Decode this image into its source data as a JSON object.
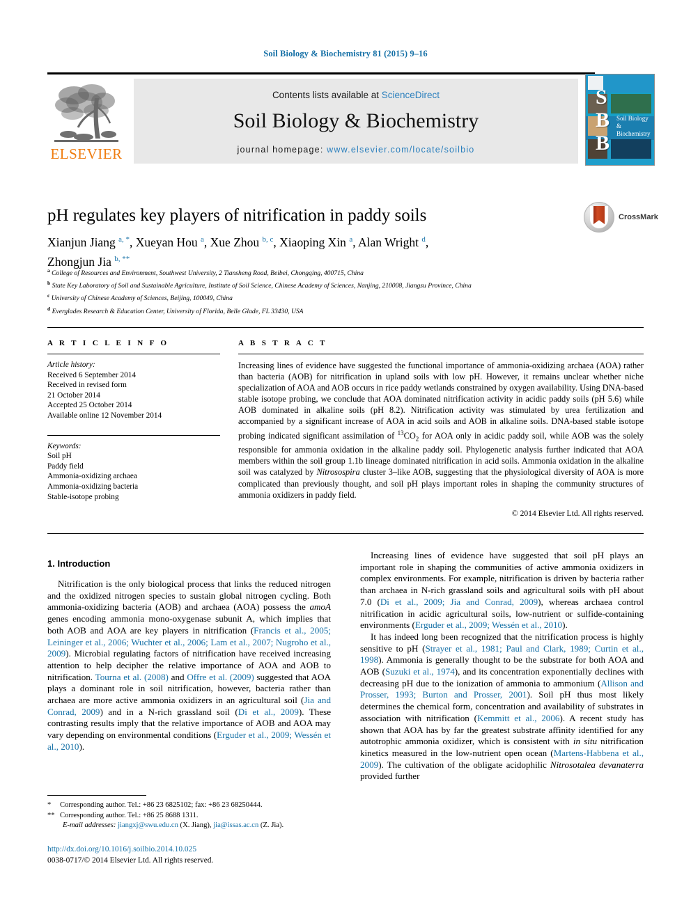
{
  "running_head": "Soil Biology & Biochemistry 81 (2015) 9–16",
  "masthead": {
    "contents_prefix": "Contents lists available at ",
    "sciencedirect": "ScienceDirect",
    "journal_title": "Soil Biology & Biochemistry",
    "homepage_label": "journal homepage: ",
    "homepage_url": "www.elsevier.com/locate/soilbio",
    "elsevier_wordmark": "ELSEVIER",
    "cover_letters": "S\nB\nB",
    "cover_name": "Soil Biology & Biochemistry"
  },
  "crossmark": {
    "label": "CrossMark"
  },
  "article": {
    "title": "pH regulates key players of nitrification in paddy soils",
    "authors_line1": "Xianjun Jiang a, *, Xueyan Hou a, Xue Zhou b, c, Xiaoping Xin a, Alan Wright d,",
    "authors_line2": "Zhongjun Jia b, **",
    "affiliations": [
      {
        "mark": "a",
        "text": "College of Resources and Environment, Southwest University, 2 Tiansheng Road, Beibei, Chongqing, 400715, China"
      },
      {
        "mark": "b",
        "text": "State Key Laboratory of Soil and Sustainable Agriculture, Institute of Soil Science, Chinese Academy of Sciences, Nanjing, 210008, Jiangsu Province, China"
      },
      {
        "mark": "c",
        "text": "University of Chinese Academy of Sciences, Beijing, 100049, China"
      },
      {
        "mark": "d",
        "text": "Everglades Research & Education Center, University of Florida, Belle Glade, FL 33430, USA"
      }
    ]
  },
  "article_info": {
    "heading": "A R T I C L E   I N F O",
    "history_label": "Article history:",
    "history": [
      "Received 6 September 2014",
      "Received in revised form",
      "21 October 2014",
      "Accepted 25 October 2014",
      "Available online 12 November 2014"
    ],
    "keywords_label": "Keywords:",
    "keywords": [
      "Soil pH",
      "Paddy field",
      "Ammonia-oxidizing archaea",
      "Ammonia-oxidizing bacteria",
      "Stable-isotope probing"
    ]
  },
  "abstract": {
    "heading": "A B S T R A C T",
    "p1": "Increasing lines of evidence have suggested the functional importance of ammonia-oxidizing archaea (AOA) rather than bacteria (AOB) for nitrification in upland soils with low pH. However, it remains unclear whether niche specialization of AOA and AOB occurs in rice paddy wetlands constrained by oxygen availability. Using DNA-based stable isotope probing, we conclude that AOA dominated nitrification activity in acidic paddy soils (pH 5.6) while AOB dominated in alkaline soils (pH 8.2). Nitrification activity was stimulated by urea fertilization and accompanied by a significant increase of AOA in acid soils and AOB in alkaline soils. DNA-based stable isotope probing indicated significant assimilation of ",
    "iso": "13",
    "iso_tail": "CO",
    "iso_sub": "2",
    "p2": " for AOA only in acidic paddy soil, while AOB was the solely responsible for ammonia oxidation in the alkaline paddy soil. Phylogenetic analysis further indicated that AOA members within the soil group 1.1b lineage dominated nitrification in acid soils. Ammonia oxidation in the alkaline soil was catalyzed by ",
    "genus": "Nitrosospira",
    "p3": " cluster 3–like AOB, suggesting that the physiological diversity of AOA is more complicated than previously thought, and soil pH plays important roles in shaping the community structures of ammonia oxidizers in paddy field.",
    "copyright": "© 2014 Elsevier Ltd. All rights reserved."
  },
  "body": {
    "intro_heading": "1.  Introduction",
    "left_p1_a": "Nitrification is the only biological process that links the reduced nitrogen and the oxidized nitrogen species to sustain global nitrogen cycling. Both ammonia-oxidizing bacteria (AOB) and archaea (AOA) possess the ",
    "left_p1_amoa": "amoA",
    "left_p1_b": " genes encoding ammonia mono-oxygenase subunit A, which implies that both AOB and AOA are key players in nitrification (",
    "left_cite1": "Francis et al., 2005; Leininger et al., 2006; Wuchter et al., 2006; Lam et al., 2007; Nugroho et al., 2009",
    "left_p1_c": "). Microbial regulating factors of nitrification have received increasing attention to help decipher the relative importance of AOA and AOB to nitrification. ",
    "left_cite2": "Tourna et al. (2008)",
    "left_p1_d": " and ",
    "left_cite3": "Offre et al. (2009)",
    "left_p1_e": " suggested that AOA plays a dominant role in soil nitrification, however, bacteria rather than archaea are more active ammonia oxidizers in an agricultural soil (",
    "left_cite4": "Jia and Conrad, 2009",
    "left_p1_f": ") and in a N-rich grassland soil (",
    "left_cite5": "Di et al., 2009",
    "left_p1_g": "). These contrasting results imply that the relative importance of AOB and AOA may vary depending on environmental conditions (",
    "left_cite6": "Erguder et al., 2009; Wessén et al., 2010",
    "left_p1_h": ").",
    "right_p1_a": "Increasing lines of evidence have suggested that soil pH plays an important role in shaping the communities of active ammonia oxidizers in complex environments. For example, nitrification is driven by bacteria rather than archaea in N-rich grassland soils and agricultural soils with pH about 7.0 (",
    "right_cite1": "Di et al., 2009; Jia and Conrad, 2009",
    "right_p1_b": "), whereas archaea control nitrification in acidic agricultural soils, low-nutrient or sulfide-containing environments (",
    "right_cite2": "Erguder et al., 2009; Wessén et al., 2010",
    "right_p1_c": ").",
    "right_p2_a": "It has indeed long been recognized that the nitrification process is highly sensitive to pH (",
    "right_cite3": "Strayer et al., 1981; Paul and Clark, 1989; Curtin et al., 1998",
    "right_p2_b": "). Ammonia is generally thought to be the substrate for both AOA and AOB (",
    "right_cite4": "Suzuki et al., 1974",
    "right_p2_c": "), and its concentration exponentially declines with decreasing pH due to the ionization of ammonia to ammonium (",
    "right_cite5": "Allison and Prosser, 1993; Burton and Prosser, 2001",
    "right_p2_d": "). Soil pH thus most likely determines the chemical form, concentration and availability of substrates in association with nitrification (",
    "right_cite6": "Kemmitt et al., 2006",
    "right_p2_e": "). A recent study has shown that AOA has by far the greatest substrate affinity identified for any autotrophic ammonia oxidizer, which is consistent with ",
    "right_insitu": "in situ",
    "right_p2_f": " nitrification kinetics measured in the low-nutrient open ocean (",
    "right_cite7": "Martens-Habbena et al., 2009",
    "right_p2_g": "). The cultivation of the obligate acidophilic ",
    "right_species": "Nitrosotalea devanaterra",
    "right_p2_h": " provided further"
  },
  "footnotes": {
    "note1_mark": "*",
    "note1": "Corresponding author. Tel.: +86 23 6825102; fax: +86 23 68250444.",
    "note2_mark": "**",
    "note2": "Corresponding author. Tel.: +86 25 8688 1311.",
    "email_label": "E-mail addresses:",
    "email1": "jiangxj@swu.edu.cn",
    "email1_owner": " (X. Jiang), ",
    "email2": "jia@issas.ac.cn",
    "email2_owner": " (Z. Jia).",
    "doi": "http://dx.doi.org/10.1016/j.soilbio.2014.10.025",
    "issn": "0038-0717/© 2014 Elsevier Ltd. All rights reserved."
  },
  "colors": {
    "link": "#1570a6",
    "elsevier_orange": "#ef7d11",
    "cover_blue": "#1a93c9",
    "banner_gray": "#e8e8e8"
  }
}
